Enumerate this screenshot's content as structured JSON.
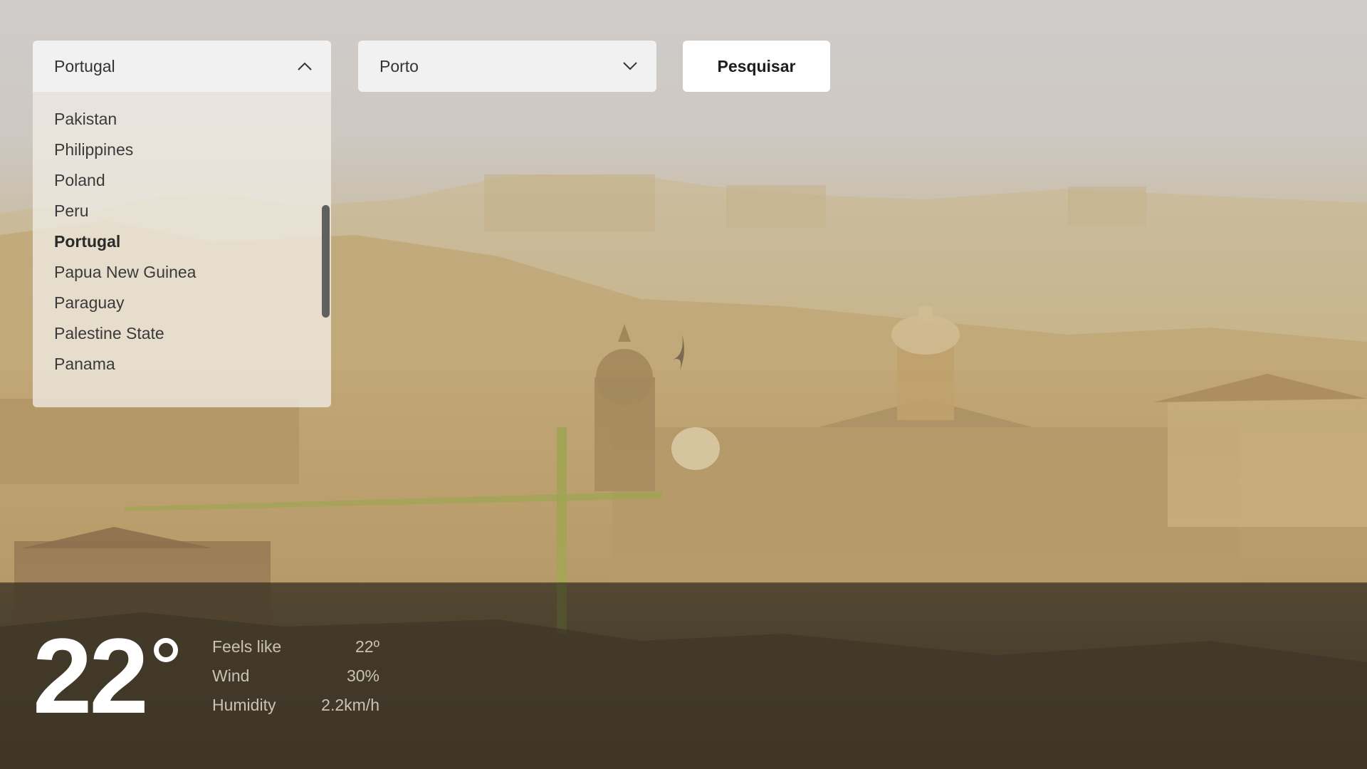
{
  "country_select": {
    "value": "Portugal",
    "expanded": true,
    "icon": "chevron-up-icon",
    "options": [
      "Pakistan",
      "Philippines",
      "Poland",
      "Peru",
      "Portugal",
      "Papua New Guinea",
      "Paraguay",
      "Palestine State",
      "Panama"
    ],
    "selected_index": 4
  },
  "city_select": {
    "value": "Porto",
    "icon": "chevron-down-icon"
  },
  "search_button": {
    "label": "Pesquisar"
  },
  "weather": {
    "temperature": "22",
    "stats": [
      {
        "label": "Feels like",
        "value": "22º"
      },
      {
        "label": "Wind",
        "value": "30%"
      },
      {
        "label": "Humidity",
        "value": "2.2km/h"
      }
    ]
  },
  "colors": {
    "panel": "#f1f1f1",
    "button_bg": "#ffffff",
    "stat_text": "#c9c2b6",
    "temperature_text": "#ffffff"
  }
}
